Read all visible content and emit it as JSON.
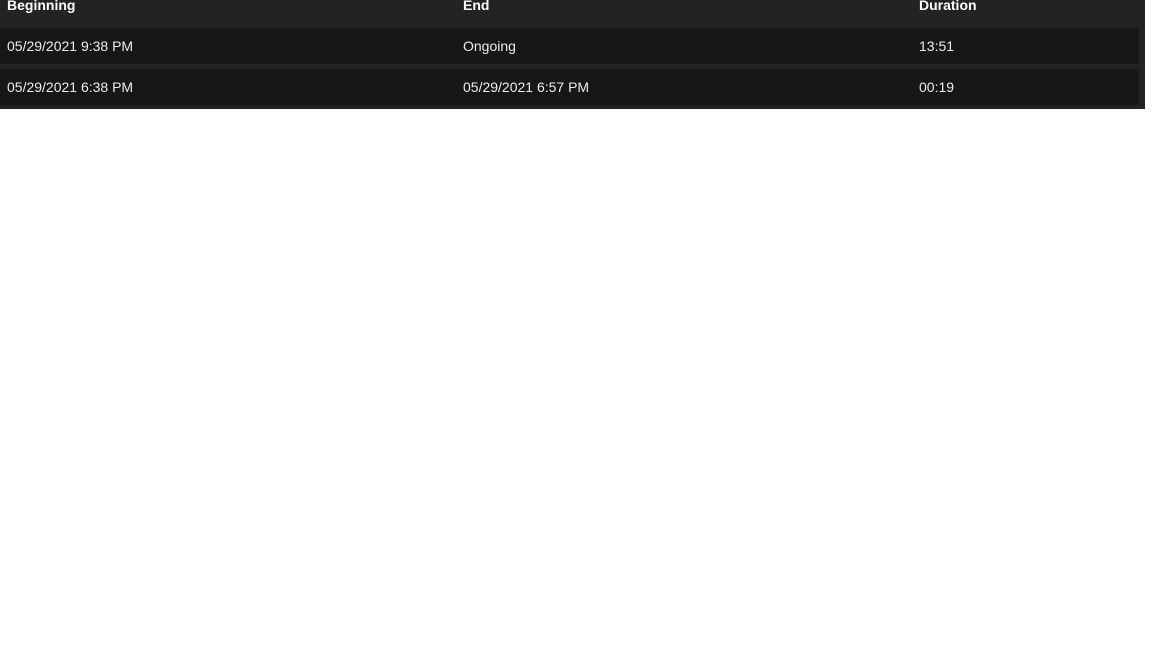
{
  "table": {
    "headers": [
      "Beginning",
      "End",
      "Duration"
    ],
    "rows": [
      {
        "beginning": "05/29/2021 9:38 PM",
        "end": "Ongoing",
        "duration": "13:51"
      },
      {
        "beginning": "05/29/2021 6:38 PM",
        "end": "05/29/2021 6:57 PM",
        "duration": "00:19"
      }
    ]
  },
  "colors": {
    "panel_bg": "#232323",
    "row_bg": "#171717",
    "text": "#ececec",
    "page_bg": "#ffffff"
  }
}
